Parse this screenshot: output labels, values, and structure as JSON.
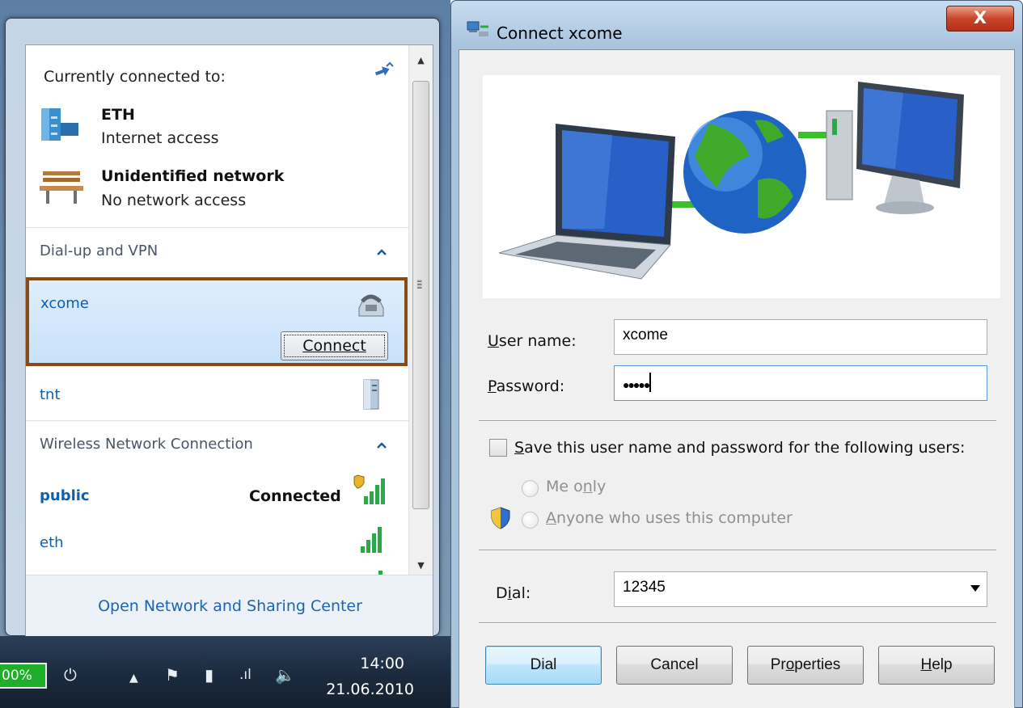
{
  "flyout": {
    "currently_connected_label": "Currently connected to:",
    "connections": [
      {
        "name": "ETH",
        "status": "Internet access",
        "icon": "network-building-icon"
      },
      {
        "name": "Unidentified network",
        "status": "No network access",
        "icon": "park-bench-icon"
      }
    ],
    "dialup_section": {
      "title": "Dial-up and VPN",
      "selected": {
        "name": "xcome",
        "button_label": "Connect",
        "icon": "dialup-phone-icon"
      },
      "other": {
        "name": "tnt",
        "icon": "vpn-server-icon"
      }
    },
    "wireless_section": {
      "title": "Wireless Network Connection",
      "networks": [
        {
          "name": "public",
          "status": "Connected",
          "icon": "wifi-signal-shield-icon"
        },
        {
          "name": "eth",
          "status": "",
          "icon": "wifi-signal-icon"
        }
      ]
    },
    "footer_link": "Open Network and Sharing Center"
  },
  "taskbar": {
    "battery": "00%",
    "time": "14:00",
    "date": "21.06.2010"
  },
  "dialog": {
    "title": "Connect xcome",
    "close_label": "X",
    "username_label_u": "U",
    "username_label_rest": "ser name:",
    "username_value": "xcome",
    "password_label_u": "P",
    "password_label_rest": "assword:",
    "password_value": "●●●●●",
    "save_label_u": "S",
    "save_label_rest": "ave this user name and password for the following users:",
    "radio_me_pre": "Me o",
    "radio_me_u": "n",
    "radio_me_post": "ly",
    "radio_anyone_u": "A",
    "radio_anyone_rest": "nyone who uses this computer",
    "dial_label_pre": "D",
    "dial_label_u": "i",
    "dial_label_post": "al:",
    "dial_value": "12345",
    "buttons": {
      "dial": "Dial",
      "cancel": "Cancel",
      "properties_pre": "Pr",
      "properties_u": "o",
      "properties_post": "perties",
      "help_u": "H",
      "help_rest": "elp"
    }
  },
  "colors": {
    "link_blue": "#0e5fb0",
    "selection_border": "#8a4a12",
    "close_red": "#c8442a",
    "battery_green": "#1fae2a"
  }
}
